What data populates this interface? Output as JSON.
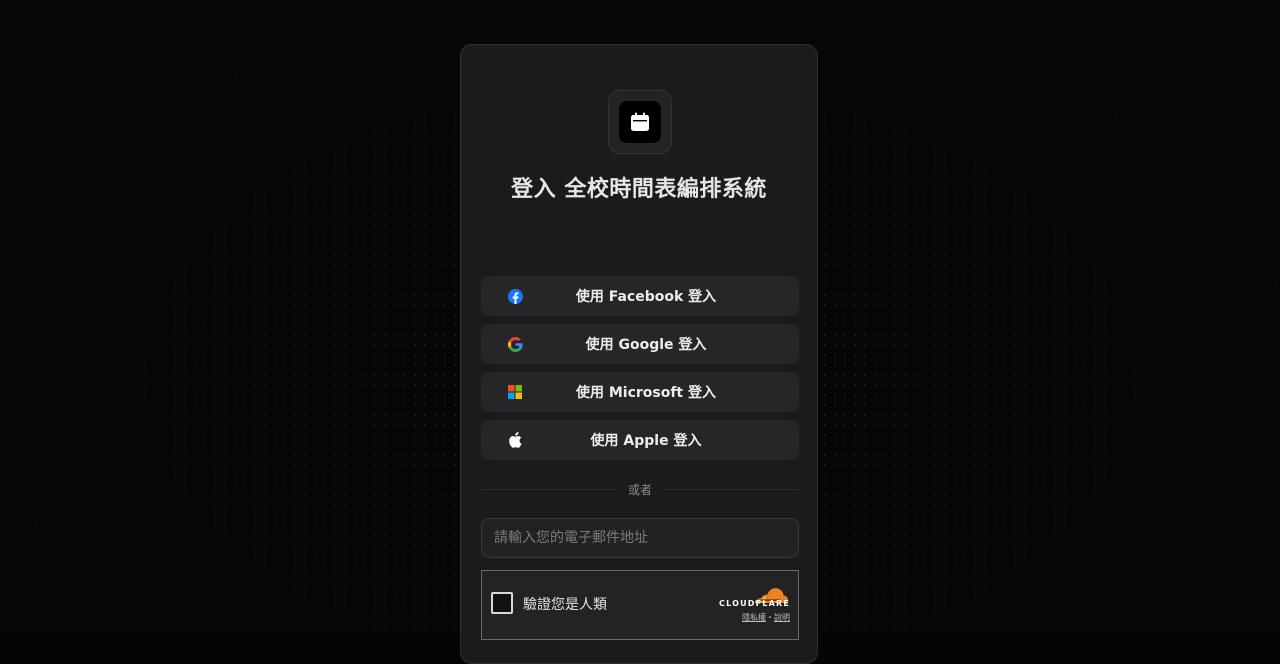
{
  "app": {
    "title": "登入 全校時間表編排系統",
    "logo_icon": "calendar-icon"
  },
  "social_login": [
    {
      "id": "facebook",
      "label": "使用 Facebook 登入",
      "icon": "facebook-icon",
      "color": "#1877F2"
    },
    {
      "id": "google",
      "label": "使用 Google 登入",
      "icon": "google-icon",
      "color": "#4285F4"
    },
    {
      "id": "microsoft",
      "label": "使用 Microsoft 登入",
      "icon": "microsoft-icon",
      "color": "#F25022"
    },
    {
      "id": "apple",
      "label": "使用 Apple 登入",
      "icon": "apple-icon",
      "color": "#FFFFFF"
    }
  ],
  "divider": {
    "text": "或者"
  },
  "email": {
    "placeholder": "請輸入您的電子郵件地址",
    "value": ""
  },
  "captcha": {
    "label": "驗證您是人類",
    "brand": "CLOUDFLARE",
    "brand_color": "#F38020",
    "privacy_link": "隱私權",
    "separator": "・",
    "help_link": "說明"
  }
}
